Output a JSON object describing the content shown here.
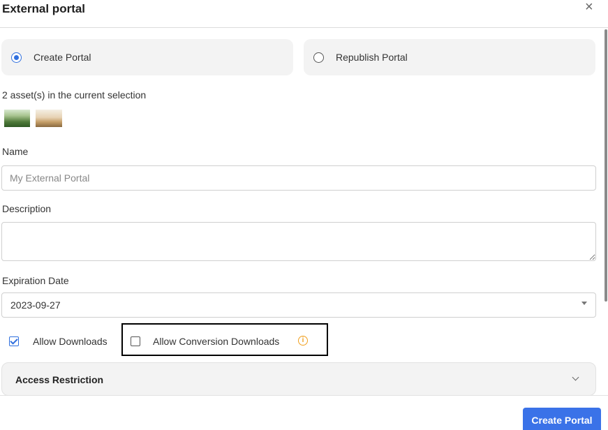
{
  "dialog": {
    "title": "External portal",
    "close_icon": "×"
  },
  "mode": {
    "options": [
      {
        "label": "Create Portal",
        "selected": true
      },
      {
        "label": "Republish Portal",
        "selected": false
      }
    ]
  },
  "selection": {
    "text": "2 asset(s) in the current selection",
    "thumbnails": [
      "landscape-thumbnail",
      "vehicle-thumbnail"
    ]
  },
  "form": {
    "name_label": "Name",
    "name_placeholder": "My External Portal",
    "name_value": "",
    "description_label": "Description",
    "description_value": "",
    "expiration_label": "Expiration Date",
    "expiration_value": "2023-09-27",
    "allow_downloads_label": "Allow Downloads",
    "allow_downloads_checked": true,
    "allow_conversion_label": "Allow Conversion Downloads",
    "allow_conversion_checked": false,
    "info_icon": "i"
  },
  "access_restriction": {
    "label": "Access Restriction"
  },
  "footer": {
    "create_button_label": "Create Portal"
  },
  "colors": {
    "accent": "#3a72e8",
    "info": "#f0a020",
    "card_bg": "#f3f3f3"
  }
}
